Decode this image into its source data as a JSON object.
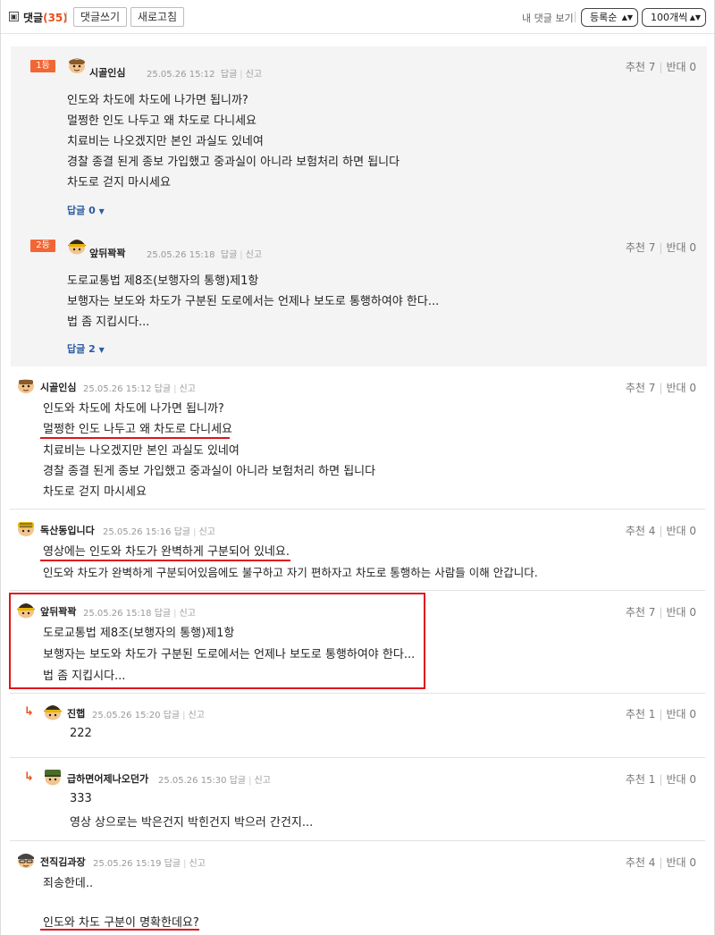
{
  "header": {
    "fold_icon": "▣",
    "title": "댓글",
    "count": "(35)",
    "write_button": "댓글쓰기",
    "refresh_button": "새로고침",
    "my_comments": "내 댓글 보기",
    "sort_select": "등록순",
    "per_page_select": "100개씩"
  },
  "best_comments": [
    {
      "rank": "1등",
      "nickname": "시골인심",
      "date": "25.05.26 15:12",
      "reply": "답글",
      "report": "신고",
      "recommend": "추천 7",
      "oppose": "반대 0",
      "lines": [
        "인도와 차도에 차도에 나가면 됩니까?",
        "멀쩡한 인도 나두고 왜 차도로 다니세요",
        "치료비는 나오겠지만 본인 과실도 있네여",
        "경찰 종결 된게 종보 가입했고 중과실이 아니라 보험처리 하면 됩니다",
        "차도로 걷지 마시세요"
      ],
      "replies_link": "답글 0"
    },
    {
      "rank": "2등",
      "nickname": "앞뒤꽉꽉",
      "date": "25.05.26 15:18",
      "reply": "답글",
      "report": "신고",
      "recommend": "추천 7",
      "oppose": "반대 0",
      "lines": [
        "도로교통법 제8조(보행자의 통행)제1항",
        "보행자는 보도와 차도가 구분된 도로에서는 언제나 보도로 통행하여야 한다...",
        "법 좀 지킵시다..."
      ],
      "replies_link": "답글 2"
    }
  ],
  "comments": [
    {
      "nickname": "시골인심",
      "date": "25.05.26 15:12",
      "reply": "답글",
      "report": "신고",
      "recommend": "추천 7",
      "oppose": "반대 0",
      "lines": [
        "인도와 차도에 차도에 나가면 됩니까?",
        "멀쩡한 인도 나두고 왜 차도로 다니세요",
        "치료비는 나오겠지만 본인 과실도 있네여",
        "경찰 종결 된게 종보 가입했고 중과실이 아니라 보험처리 하면 됩니다",
        "차도로 걷지 마시세요"
      ]
    },
    {
      "nickname": "독산동입니다",
      "date": "25.05.26 15:16",
      "reply": "답글",
      "report": "신고",
      "recommend": "추천 4",
      "oppose": "반대 0",
      "lines": [
        "영상에는 인도와 차도가 완벽하게 구분되어 있네요.",
        "인도와 차도가 완벽하게 구분되어있음에도 불구하고 자기 편하자고 차도로 통행하는 사람들 이해 안갑니다."
      ]
    },
    {
      "nickname": "앞뒤꽉꽉",
      "date": "25.05.26 15:18",
      "reply": "답글",
      "report": "신고",
      "recommend": "추천 7",
      "oppose": "반대 0",
      "lines": [
        "도로교통법 제8조(보행자의 통행)제1항",
        "보행자는 보도와 차도가 구분된 도로에서는 언제나 보도로 통행하여야 한다...",
        "법 좀 지킵시다..."
      ]
    },
    {
      "nickname": "진햅",
      "date": "25.05.26 15:20",
      "reply": "답글",
      "report": "신고",
      "recommend": "추천 1",
      "oppose": "반대 0",
      "lines": [
        "222"
      ]
    },
    {
      "nickname": "급하면어제나오던가",
      "date": "25.05.26 15:30",
      "reply": "답글",
      "report": "신고",
      "recommend": "추천 1",
      "oppose": "반대 0",
      "lines": [
        "333",
        "영상 상으로는 박은건지 박힌건지 박으러 간건지..."
      ]
    },
    {
      "nickname": "전직김과장",
      "date": "25.05.26 15:19",
      "reply": "답글",
      "report": "신고",
      "recommend": "추천 4",
      "oppose": "반대 0",
      "lines": [
        "죄송한데..",
        "인도와 차도 구분이 명확한데요?"
      ]
    }
  ],
  "reply_arrow_icon": "↳",
  "colors": {
    "accent": "#f26634",
    "count": "#e8521c",
    "link": "#2a5ba0",
    "annotation_red": "#e0141b"
  }
}
